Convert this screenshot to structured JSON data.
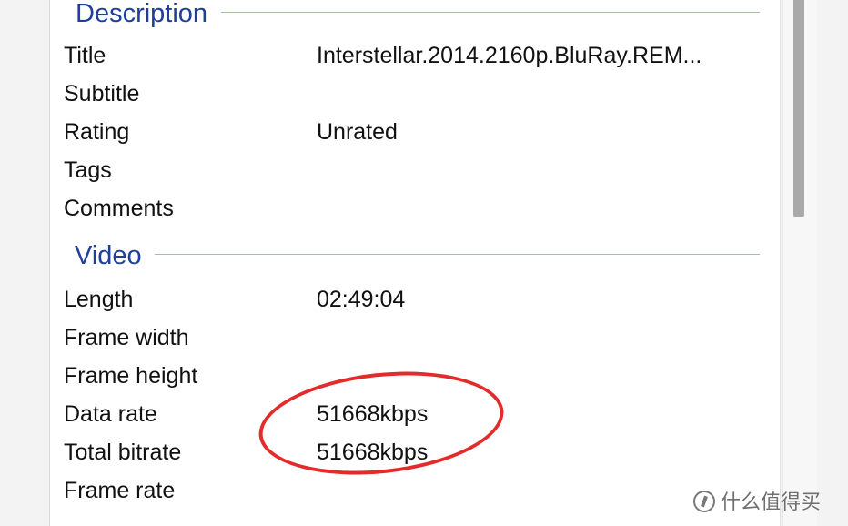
{
  "description": {
    "title": "Description",
    "rows": [
      {
        "label": "Title",
        "value": "Interstellar.2014.2160p.BluRay.REM..."
      },
      {
        "label": "Subtitle",
        "value": ""
      },
      {
        "label": "Rating",
        "value": "Unrated"
      },
      {
        "label": "Tags",
        "value": ""
      },
      {
        "label": "Comments",
        "value": ""
      }
    ]
  },
  "video": {
    "title": "Video",
    "rows": [
      {
        "label": "Length",
        "value": "02:49:04"
      },
      {
        "label": "Frame width",
        "value": ""
      },
      {
        "label": "Frame height",
        "value": ""
      },
      {
        "label": "Data rate",
        "value": "51668kbps"
      },
      {
        "label": "Total bitrate",
        "value": "51668kbps"
      },
      {
        "label": "Frame rate",
        "value": ""
      }
    ]
  },
  "watermark": {
    "text": "什么值得买"
  },
  "colors": {
    "section_title": "#1f3f9a",
    "highlight_ellipse": "#e32b2b"
  }
}
